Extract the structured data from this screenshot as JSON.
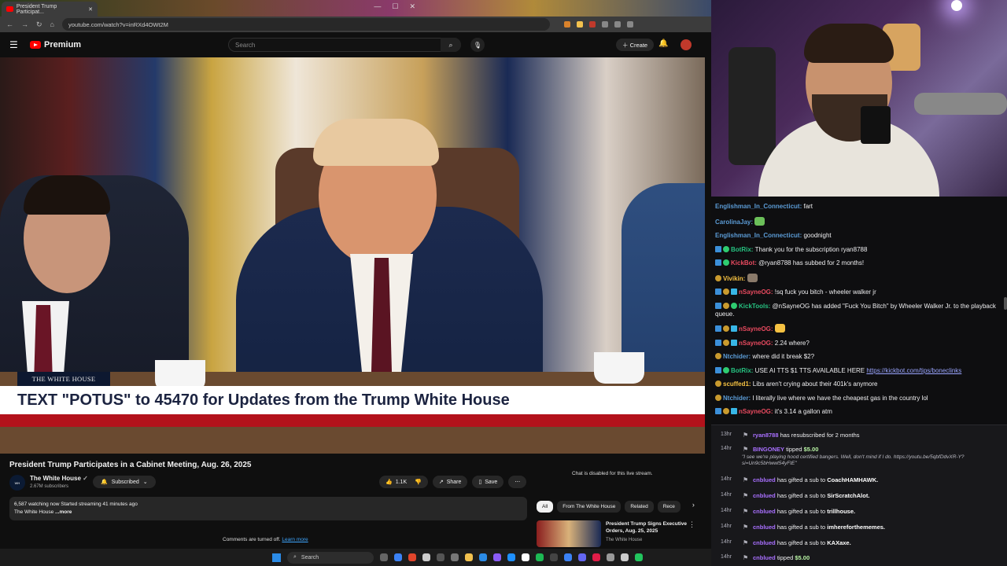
{
  "browser": {
    "tab_title": "President Trump Participat...",
    "url": "youtube.com/watch?v=inRXd4OWt2M"
  },
  "youtube": {
    "brand": "Premium",
    "search_placeholder": "Search",
    "create_label": "Create"
  },
  "video": {
    "tag": "THE WHITE HOUSE",
    "lower_third": "TEXT \"POTUS\" to 45470 for Updates from the Trump White House"
  },
  "meta": {
    "title": "President Trump Participates in a Cabinet Meeting, Aug. 26, 2025",
    "channel": "The White House",
    "subscribers": "2.67M subscribers",
    "subscribed_label": "Subscribed",
    "likes": "1.1K",
    "share": "Share",
    "save": "Save",
    "desc_line1": "6,587 watching now  Started streaming 41 minutes ago",
    "desc_line2": "The White House",
    "more": "...more",
    "comments_off": "Comments are turned off.",
    "learn_more": "Learn more",
    "chat_disabled": "Chat is disabled for this live stream."
  },
  "chips": [
    "All",
    "From The White House",
    "Related",
    "Rece"
  ],
  "recommendation": {
    "title": "President Trump Signs Executive Orders, Aug. 25, 2025",
    "channel": "The White House"
  },
  "taskbar": {
    "search": "Search"
  },
  "chat": [
    {
      "user": "Englishman_In_Connecticut",
      "color": "blue",
      "badges": [],
      "text": "fart"
    },
    {
      "user": "CarolinaJay",
      "color": "blue",
      "badges": [],
      "text": "",
      "emote": "#6bbf59"
    },
    {
      "user": "Englishman_In_Connecticut",
      "color": "blue",
      "badges": [],
      "text": "goodnight"
    },
    {
      "user": "BotRix",
      "color": "green",
      "badges": [
        "sword",
        "check"
      ],
      "text": "Thank you for the subscription ryan8788"
    },
    {
      "user": "KickBot",
      "color": "red",
      "badges": [
        "sword",
        "check"
      ],
      "text": "@ryan8788 has subbed for 2 months!"
    },
    {
      "user": "Vivikin",
      "color": "yellow",
      "badges": [
        "gold"
      ],
      "text": "",
      "emote": "#8a7a6a"
    },
    {
      "user": "nSayneOG",
      "color": "red",
      "badges": [
        "sword",
        "gold",
        "cube"
      ],
      "text": "!sq fuck you bitch - wheeler walker jr"
    },
    {
      "user": "KickTools",
      "color": "green",
      "badges": [
        "sword",
        "gold",
        "check"
      ],
      "text": "@nSayneOG has added \"Fuck You Bitch\" by Wheeler Walker Jr. to the playback queue.",
      "wrap": true
    },
    {
      "user": "nSayneOG",
      "color": "red",
      "badges": [
        "sword",
        "gold",
        "cube"
      ],
      "text": "",
      "emote": "#f5c142"
    },
    {
      "user": "nSayneOG",
      "color": "red",
      "badges": [
        "sword",
        "gold",
        "cube"
      ],
      "text": "2.24 where?"
    },
    {
      "user": "Ntchider",
      "color": "blue",
      "badges": [
        "gold"
      ],
      "text": "where did it break $2?"
    },
    {
      "user": "BotRix",
      "color": "green",
      "badges": [
        "sword",
        "check"
      ],
      "text": "USE AI TTS $1 TTS AVAILABLE HERE ",
      "link": "https://kickbot.com/tips/boneclinks"
    },
    {
      "user": "scuffed1",
      "color": "yellow",
      "badges": [
        "gold"
      ],
      "text": "Libs aren't crying about their 401k's anymore"
    },
    {
      "user": "Ntchider",
      "color": "blue",
      "badges": [
        "gold"
      ],
      "text": "I literally live where we have the cheapest gas in the country lol"
    },
    {
      "user": "nSayneOG",
      "color": "red",
      "badges": [
        "sword",
        "gold",
        "cube"
      ],
      "text": "it's 3.14 a gallon atm"
    }
  ],
  "events": [
    {
      "time": "13hr",
      "name": "ryan8788",
      "text": " has resubscribed for 2 months"
    },
    {
      "time": "14hr",
      "name": "BINGONEY",
      "text": " tipped ",
      "money": "$5.00",
      "quote": "\"I see we're playing hood certified bangers. Well, don't mind if I do. https://youtu.be/5qbfDdvXR-Y?si=Un9c5bHwwt54yFtE\""
    },
    {
      "time": "14hr",
      "name": "cnblued",
      "text": " has gifted a sub to ",
      "target": "CoachHAMHAWK."
    },
    {
      "time": "14hr",
      "name": "cnblued",
      "text": " has gifted a sub to ",
      "target": "SirScratchAlot."
    },
    {
      "time": "14hr",
      "name": "cnblued",
      "text": " has gifted a sub to ",
      "target": "trillhouse."
    },
    {
      "time": "14hr",
      "name": "cnblued",
      "text": " has gifted a sub to ",
      "target": "imhereforthememes."
    },
    {
      "time": "14hr",
      "name": "cnblued",
      "text": " has gifted a sub to ",
      "target": "KAXaxe."
    },
    {
      "time": "14hr",
      "name": "cnblued",
      "text": " tipped ",
      "money": "$5.00"
    }
  ],
  "colors": {
    "youtube_red": "#ff0000",
    "lower_third_red": "#b3121b",
    "chat_bg": "#0e0e10",
    "events_bg": "#18181b"
  }
}
